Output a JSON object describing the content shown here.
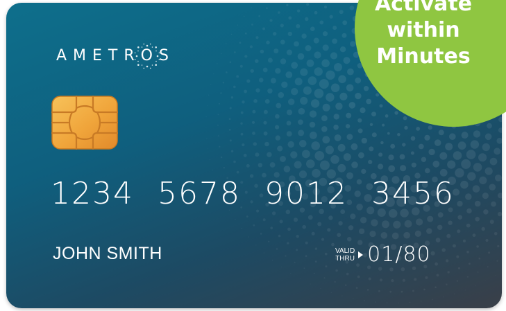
{
  "card": {
    "brand": "AMETROS",
    "number_groups": [
      "1234",
      "5678",
      "9012",
      "3456"
    ],
    "holder_name": "JOHN SMITH",
    "valid_label_top": "VALID",
    "valid_label_bottom": "THRU",
    "valid_date": "01/80"
  },
  "promo": {
    "lines": [
      "Activate",
      "within",
      "Minutes"
    ]
  },
  "colors": {
    "card_gradient_start": "#0e6f8c",
    "card_gradient_end": "#3a3f48",
    "promo_green": "#8fc641",
    "chip_gold": "#f0a53b",
    "text": "#ffffff"
  },
  "icons": {
    "chip": "emv-chip-icon",
    "arrow": "triangle-right-icon",
    "sparkle": "sparkle-ring-icon"
  }
}
